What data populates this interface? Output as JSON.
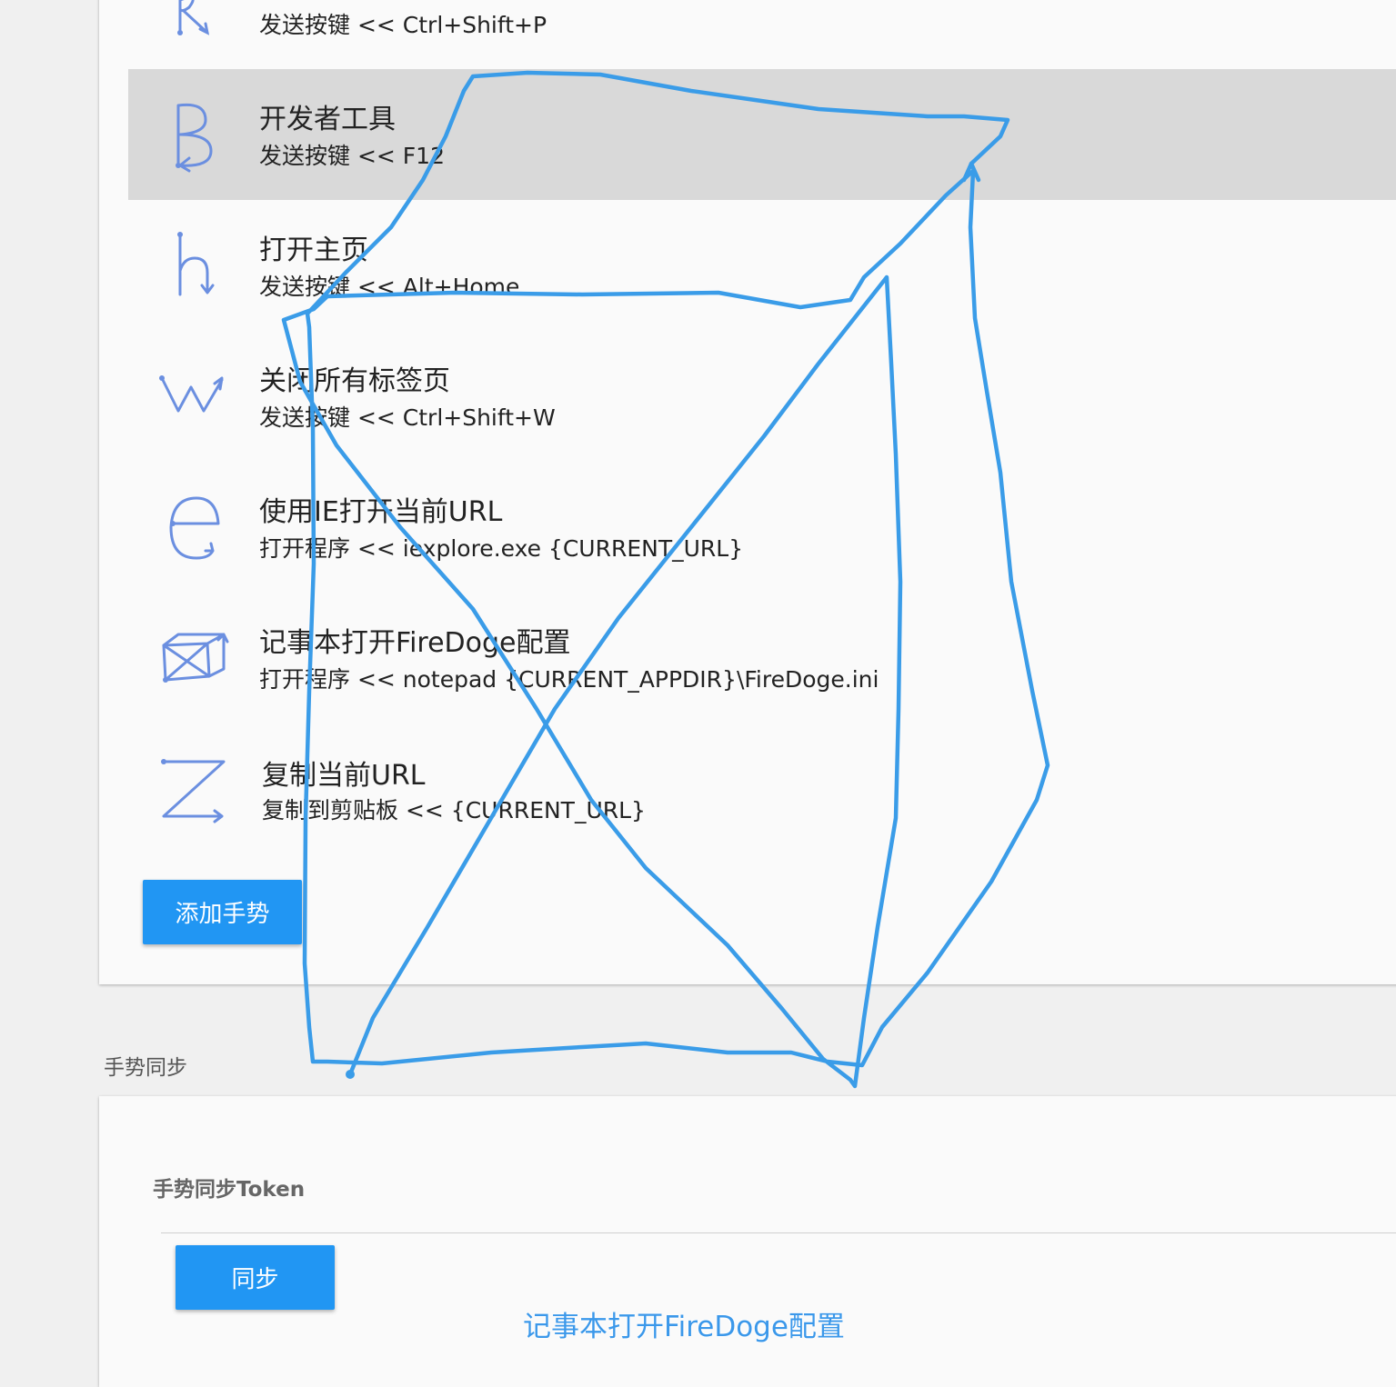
{
  "gestures": [
    {
      "icon": "gesture-r-icon",
      "title": "",
      "subtitle": "发送按键 << Ctrl+Shift+P",
      "selected": false
    },
    {
      "icon": "gesture-b-icon",
      "title": "开发者工具",
      "subtitle": "发送按键 << F12",
      "selected": true
    },
    {
      "icon": "gesture-h-icon",
      "title": "打开主页",
      "subtitle": "发送按键 << Alt+Home",
      "selected": false
    },
    {
      "icon": "gesture-w-icon",
      "title": "关闭所有标签页",
      "subtitle": "发送按键 << Ctrl+Shift+W",
      "selected": false
    },
    {
      "icon": "gesture-e-icon",
      "title": "使用IE打开当前URL",
      "subtitle": "打开程序 << iexplore.exe {CURRENT_URL}",
      "selected": false
    },
    {
      "icon": "gesture-box-icon",
      "title": "记事本打开FireDoge配置",
      "subtitle": "打开程序 << notepad {CURRENT_APPDIR}\\FireDoge.ini",
      "selected": false
    },
    {
      "icon": "gesture-z-icon",
      "title": "复制当前URL",
      "subtitle": "复制到剪贴板 << {CURRENT_URL}",
      "selected": false
    }
  ],
  "add_button_label": "添加手势",
  "sync_section": {
    "label": "手势同步",
    "token_label": "手势同步Token",
    "sync_button_label": "同步"
  },
  "overlay": {
    "recognized_gesture": "记事本打开FireDoge配置",
    "stroke_color": "#3a9ce8"
  },
  "colors": {
    "accent": "#2196f3",
    "icon_stroke": "#6b8fe0",
    "selected_row": "#d9d9d9"
  }
}
